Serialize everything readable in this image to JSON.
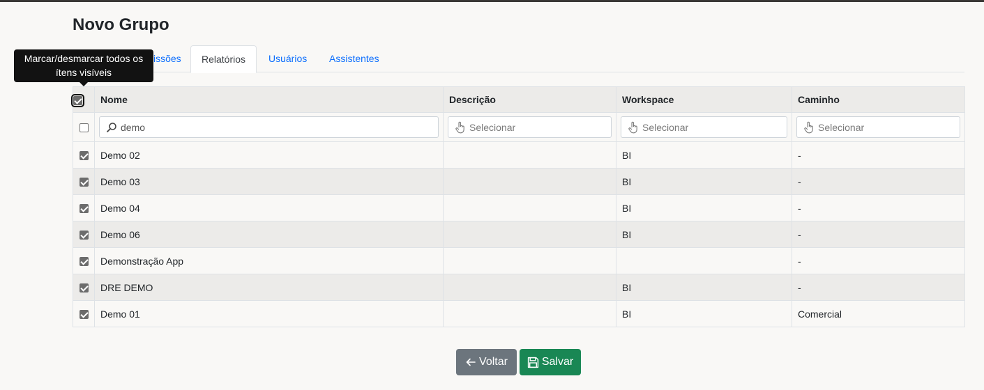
{
  "page": {
    "title": "Novo Grupo"
  },
  "tooltip": {
    "text": "Marcar/desmarcar todos os ítens visíveis"
  },
  "tabs": [
    {
      "label": "issões"
    },
    {
      "label": "Relatórios",
      "active": true
    },
    {
      "label": "Usuários"
    },
    {
      "label": "Assistentes"
    }
  ],
  "table": {
    "columns": [
      "Nome",
      "Descrição",
      "Workspace",
      "Caminho"
    ],
    "filters": {
      "nome_value": "demo",
      "descricao_placeholder": "Selecionar",
      "workspace_placeholder": "Selecionar",
      "caminho_placeholder": "Selecionar"
    },
    "rows": [
      {
        "nome": "Demo 02",
        "descricao": "",
        "workspace": "BI",
        "caminho": "-"
      },
      {
        "nome": "Demo 03",
        "descricao": "",
        "workspace": "BI",
        "caminho": "-"
      },
      {
        "nome": "Demo 04",
        "descricao": "",
        "workspace": "BI",
        "caminho": "-"
      },
      {
        "nome": "Demo 06",
        "descricao": "",
        "workspace": "BI",
        "caminho": "-"
      },
      {
        "nome": "Demonstração App",
        "descricao": "",
        "workspace": "",
        "caminho": "-"
      },
      {
        "nome": "DRE DEMO",
        "descricao": "",
        "workspace": "BI",
        "caminho": "-"
      },
      {
        "nome": "Demo 01",
        "descricao": "",
        "workspace": "BI",
        "caminho": "Comercial"
      }
    ]
  },
  "buttons": {
    "back": "Voltar",
    "save": "Salvar"
  },
  "colors": {
    "primary_link": "#0d6efd",
    "secondary": "#6c757d",
    "success": "#198754"
  },
  "icons": {
    "search": "search-icon",
    "pointer": "hand-pointer-icon",
    "back": "arrow-left-icon",
    "save": "floppy-disk-icon"
  }
}
